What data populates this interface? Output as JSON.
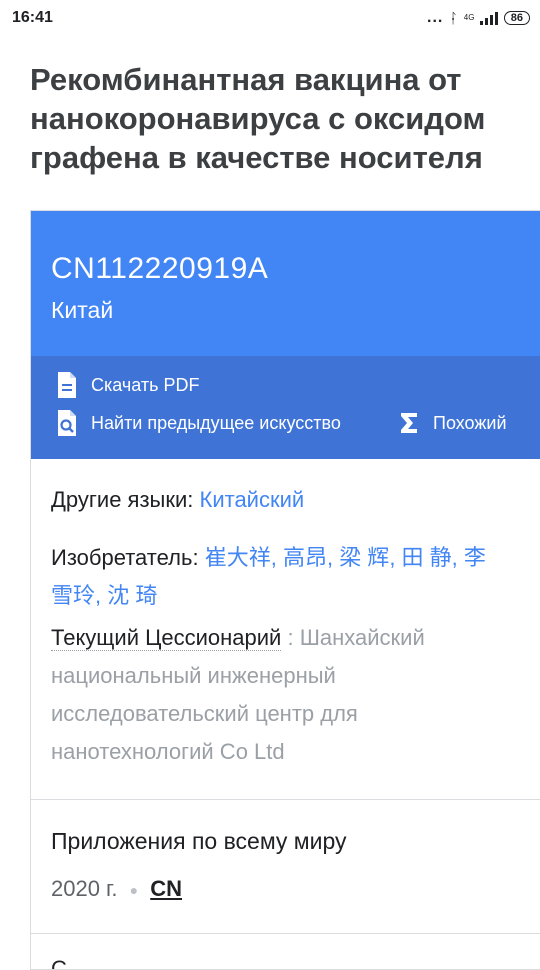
{
  "status_bar": {
    "time": "16:41",
    "dots": "...",
    "network": "4G",
    "battery": "86"
  },
  "page": {
    "title": "Рекомбинантная вакцина от нанокоронавируса с оксидом графена в качестве носителя"
  },
  "card": {
    "pub_number": "CN112220919A",
    "country": "Китай",
    "actions": {
      "download_pdf": "Скачать PDF",
      "find_prior_art": "Найти предыдущее искусство",
      "similar": "Похожий"
    },
    "other_languages": {
      "label": "Другие языки:",
      "value": "Китайский"
    },
    "inventors": {
      "label": "Изобретатель:",
      "names": [
        "崔大祥",
        "高昂",
        "梁 辉",
        "田 静",
        "李",
        "雪玲",
        "沈 琦"
      ]
    },
    "assignee": {
      "label": "Текущий Цессионарий",
      "colon": ":",
      "value": "Шанхайский национальный инженерный исследовательский центр для нанотехнологий Co Ltd"
    },
    "worldwide": {
      "title": "Приложения по всему миру",
      "year": "2020 г.",
      "country_link": "CN"
    },
    "next_section_partial": "С"
  },
  "colors": {
    "header_blue": "#4285f4",
    "actions_blue": "#3f74d6",
    "link_blue": "#4285f4",
    "muted_gray": "#9aa0a6"
  }
}
